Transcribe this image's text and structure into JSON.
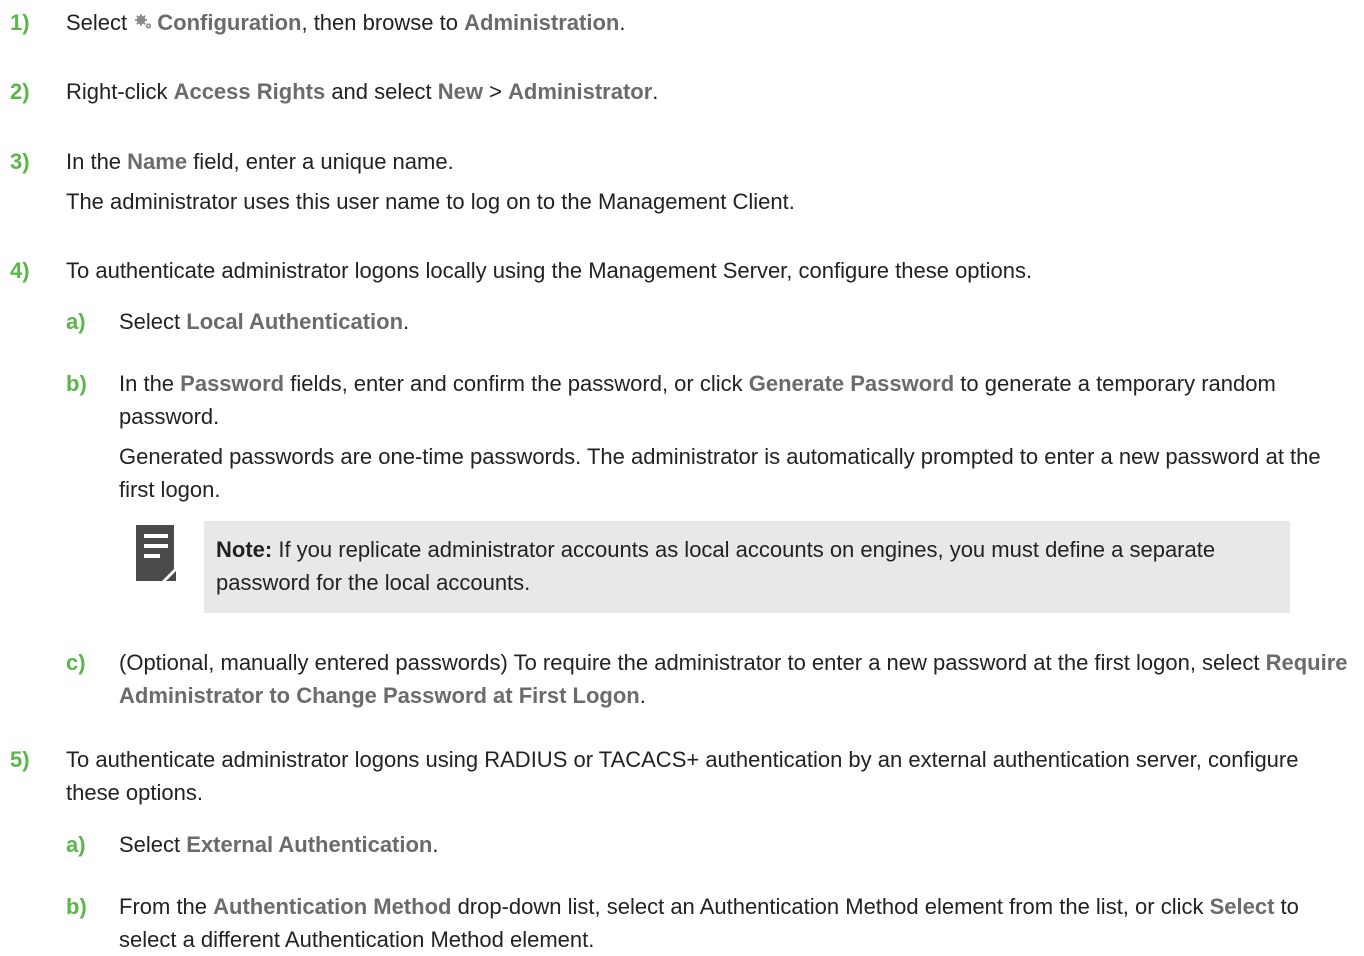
{
  "steps": [
    {
      "num": "1)",
      "pre": "Select ",
      "icon": "gear-icon",
      "ui1": "Configuration",
      "mid": ", then browse to ",
      "ui2": "Administration",
      "post": "."
    },
    {
      "num": "2)",
      "pre": "Right-click ",
      "ui1": "Access Rights",
      "mid1": " and select ",
      "ui2": "New",
      "mid2": " > ",
      "ui3": "Administrator",
      "post": "."
    },
    {
      "num": "3)",
      "pre": "In the ",
      "ui1": "Name",
      "post": " field, enter a unique name.",
      "info": "The administrator uses this user name to log on to the Management Client."
    },
    {
      "num": "4)",
      "text": "To authenticate administrator logons locally using the Management Server, configure these options.",
      "sub": [
        {
          "num": "a)",
          "pre": "Select ",
          "ui1": "Local Authentication",
          "post": "."
        },
        {
          "num": "b)",
          "pre": "In the ",
          "ui1": "Password",
          "mid": " fields, enter and confirm the password, or click ",
          "ui2": "Generate Password",
          "post": " to generate a temporary random password.",
          "info": "Generated passwords are one-time passwords. The administrator is automatically prompted to enter a new password at the first logon."
        },
        {
          "num": "c)",
          "pre": "(Optional, manually entered passwords) To require the administrator to enter a new password at the first logon, select ",
          "ui1": "Require Administrator to Change Password at First Logon",
          "post": "."
        }
      ]
    },
    {
      "num": "5)",
      "text": "To authenticate administrator logons using RADIUS or TACACS+ authentication by an external authentication server, configure these options.",
      "sub": [
        {
          "num": "a)",
          "pre": "Select ",
          "ui1": "External Authentication",
          "post": "."
        },
        {
          "num": "b)",
          "pre": "From the ",
          "ui1": "Authentication Method",
          "mid": " drop-down list, select an Authentication Method element from the list, or click ",
          "ui2": "Select",
          "post": " to select a different Authentication Method element."
        }
      ]
    }
  ],
  "note": {
    "icon": "note-icon",
    "label": "Note:",
    "text": " If you replicate administrator accounts as local accounts on engines, you must define a separate password for the local accounts."
  },
  "colors": {
    "step_number": "#5bb64a",
    "ui_term": "#6b6b6b",
    "note_bg": "#e8e8e8",
    "icon": "#4a4a4a"
  }
}
